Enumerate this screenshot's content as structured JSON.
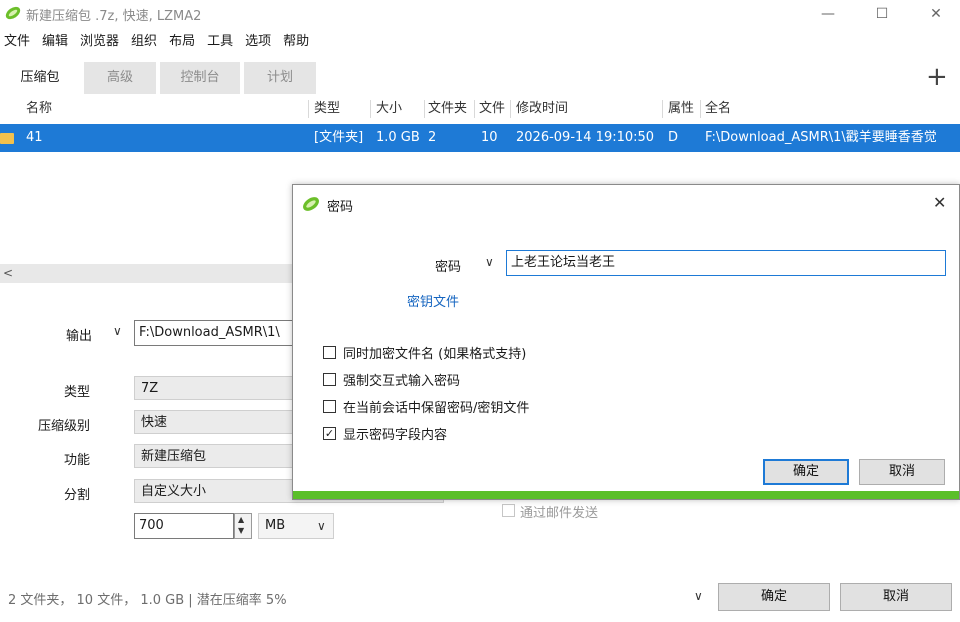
{
  "window": {
    "title": "新建压缩包 .7z, 快速, LZMA2",
    "controls": {
      "minimize": "—",
      "maximize": "☐",
      "close": "✕"
    }
  },
  "menu": [
    "文件",
    "编辑",
    "浏览器",
    "组织",
    "布局",
    "工具",
    "选项",
    "帮助"
  ],
  "tabs": [
    "压缩包",
    "高级",
    "控制台",
    "计划"
  ],
  "add_tab_glyph": "+",
  "columns": [
    "名称",
    "类型",
    "大小",
    "文件夹",
    "文件",
    "修改时间",
    "属性",
    "全名"
  ],
  "rows": [
    {
      "name": "41",
      "type": "[文件夹]",
      "size": "1.0 GB",
      "folders": "2",
      "files": "10",
      "modified": "2026-09-14 19:10:50",
      "attr": "D",
      "fullname": "F:\\Download_ASMR\\1\\戳羊要睡香香觉"
    }
  ],
  "form": {
    "output_label": "输出",
    "output_value": "F:\\Download_ASMR\\1\\",
    "type_label": "类型",
    "type_value": "7Z",
    "level_label": "压缩级别",
    "level_value": "快速",
    "function_label": "功能",
    "function_value": "新建压缩包",
    "split_label": "分割",
    "split_value": "自定义大小",
    "split_size": "700",
    "split_unit": "MB",
    "email_label": "通过邮件发送"
  },
  "status": "2 文件夹， 10 文件， 1.0 GB | 潜在压缩率 5%",
  "buttons": {
    "ok": "确定",
    "cancel": "取消"
  },
  "dialog": {
    "title": "密码",
    "password_label": "密码",
    "password_value": "上老王论坛当老王",
    "keyfile_link": "密钥文件",
    "options": [
      {
        "label": "同时加密文件名 (如果格式支持)",
        "checked": false
      },
      {
        "label": "强制交互式输入密码",
        "checked": false
      },
      {
        "label": "在当前会话中保留密码/密钥文件",
        "checked": false
      },
      {
        "label": "显示密码字段内容",
        "checked": true
      }
    ],
    "ok": "确定",
    "cancel": "取消",
    "accent_color": "#5bbf2a"
  },
  "colors": {
    "selection": "#1e7ad6",
    "link": "#1565c0"
  }
}
